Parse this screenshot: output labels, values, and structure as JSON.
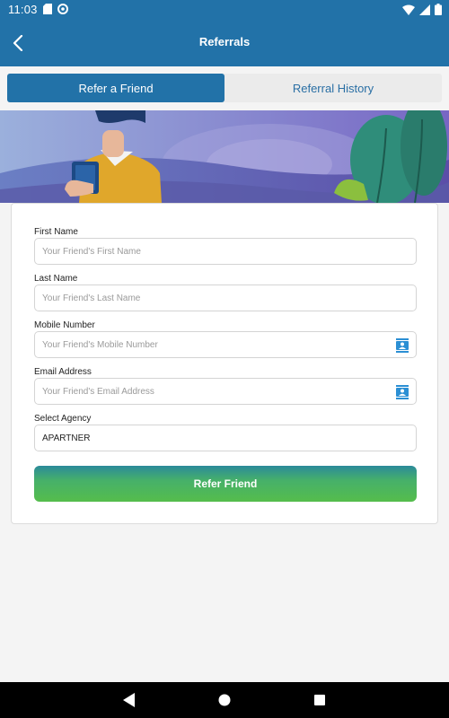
{
  "status_bar": {
    "time": "11:03",
    "left_icons": [
      "sd-card-icon",
      "sync-icon"
    ],
    "right_icons": [
      "wifi-icon",
      "signal-icon",
      "battery-icon"
    ]
  },
  "app_bar": {
    "title": "Referrals",
    "back_icon": "chevron-left-icon"
  },
  "tabs": [
    {
      "label": "Refer a Friend",
      "active": true
    },
    {
      "label": "Referral History",
      "active": false
    }
  ],
  "form": {
    "first_name": {
      "label": "First Name",
      "placeholder": "Your Friend's First Name"
    },
    "last_name": {
      "label": "Last Name",
      "placeholder": "Your Friend's Last Name"
    },
    "mobile": {
      "label": "Mobile Number",
      "placeholder": "Your Friend's Mobile Number",
      "icon": "contact-book-icon"
    },
    "email": {
      "label": "Email Address",
      "placeholder": "Your Friend's Email Address",
      "icon": "contact-book-icon"
    },
    "agency": {
      "label": "Select Agency",
      "value": "APARTNER"
    },
    "submit_label": "Refer Friend"
  },
  "nav_bar": {
    "icons": [
      "back-triangle-icon",
      "home-circle-icon",
      "recents-square-icon"
    ]
  },
  "colors": {
    "primary": "#2272a8",
    "button_gradient_top": "#2b8a9a",
    "button_gradient_bottom": "#55bd4c",
    "icon_blue": "#2b8fd4"
  }
}
